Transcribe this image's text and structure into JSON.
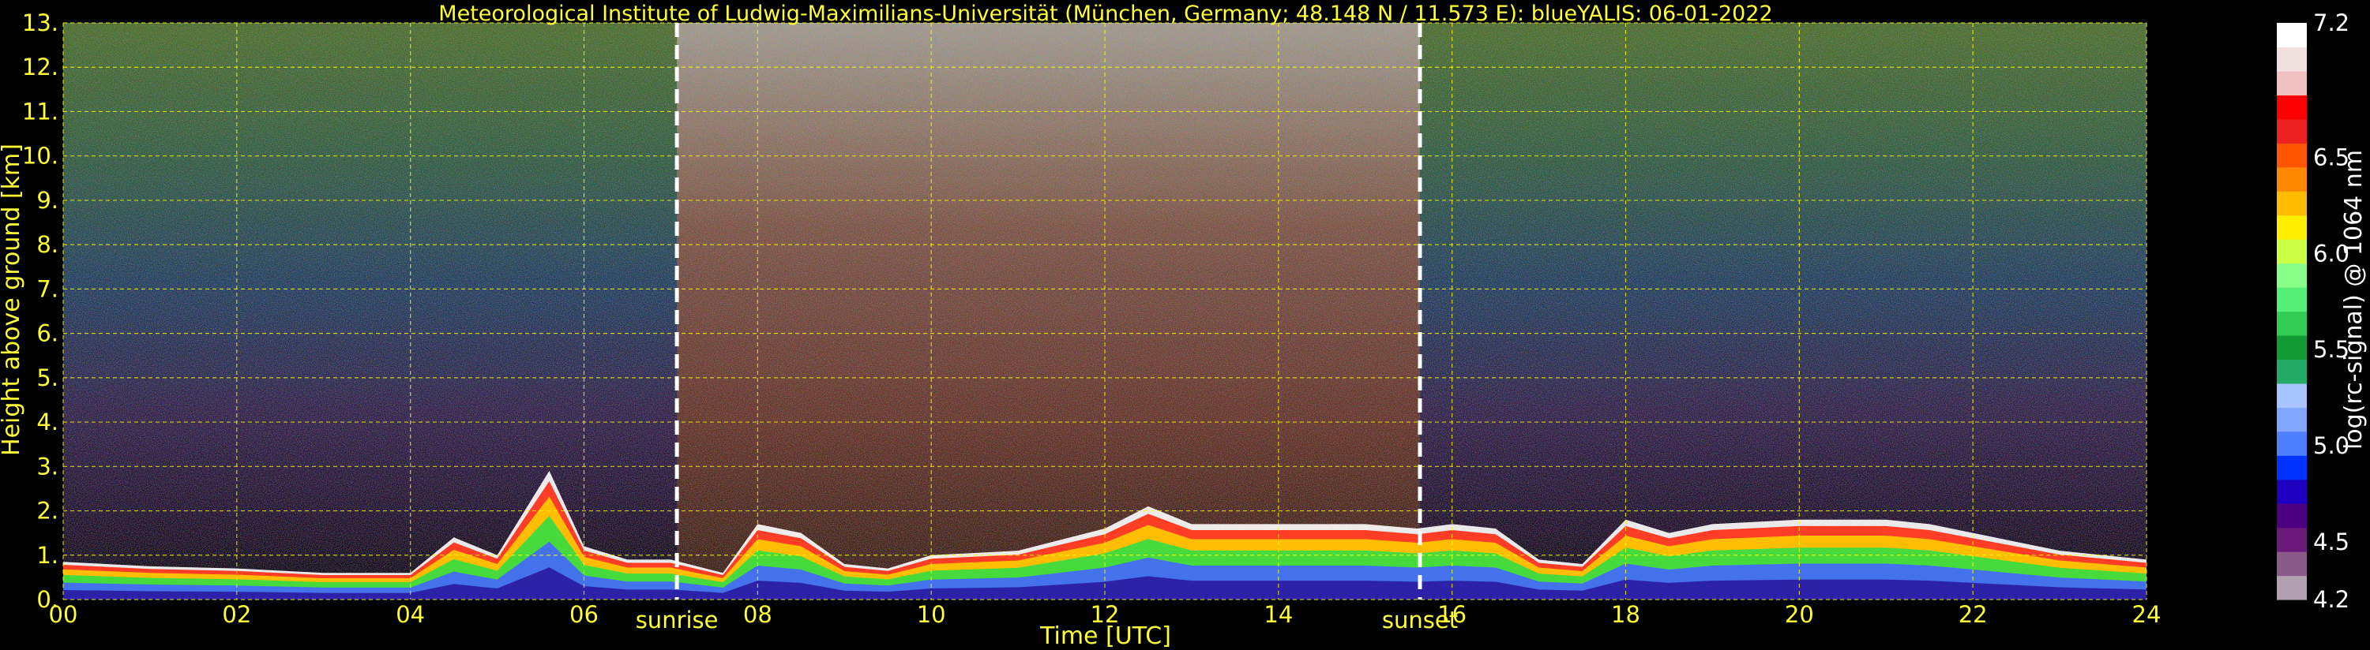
{
  "chart_data": {
    "type": "heatmap",
    "title": "Meteorological Institute of Ludwig-Maximilians-Universität (München, Germany; 48.148 N / 11.573 E):     blueYALIS: 06-01-2022",
    "xlabel": "Time [UTC]",
    "ylabel": "Height above ground [km]",
    "xlim": [
      0,
      24
    ],
    "ylim": [
      0,
      13
    ],
    "x_ticks": [
      "00",
      "02",
      "04",
      "06",
      "08",
      "10",
      "12",
      "14",
      "16",
      "18",
      "20",
      "22",
      "24"
    ],
    "y_ticks": [
      "0.",
      "1.",
      "2.",
      "3.",
      "4.",
      "5.",
      "6.",
      "7.",
      "8.",
      "9.",
      "10.",
      "11.",
      "12.",
      "13."
    ],
    "grid": true,
    "events": [
      {
        "label": "sunrise",
        "x": 7.07
      },
      {
        "label": "sunset",
        "x": 15.63
      }
    ],
    "colorbar": {
      "label": "log(rc-signal) @ 1064 nm",
      "range": [
        4.2,
        7.2
      ],
      "ticks": [
        "4.2",
        "4.5",
        "5.0",
        "5.5",
        "6.0",
        "6.5",
        "7.2"
      ],
      "colors": [
        "#b0a0b0",
        "#8a5a8a",
        "#6a1a7a",
        "#4a0080",
        "#2000c0",
        "#0033ff",
        "#4d7fff",
        "#80a6ff",
        "#a8c4ff",
        "#22aa66",
        "#119933",
        "#33cc55",
        "#55ee77",
        "#88ff88",
        "#ccff44",
        "#ffee00",
        "#ffbb00",
        "#ff8800",
        "#ff5500",
        "#ee2222",
        "#ff0000",
        "#f0c0c0",
        "#f0e0e0",
        "#ffffff"
      ]
    },
    "boundary_layer_top_km": {
      "x": [
        0,
        1,
        2,
        3,
        4,
        4.5,
        5,
        5.6,
        6,
        6.5,
        7,
        7.6,
        8,
        8.5,
        9,
        9.5,
        10,
        11,
        12,
        12.5,
        13,
        14,
        15,
        15.6,
        16,
        16.5,
        17,
        17.5,
        18,
        18.5,
        19,
        20,
        21,
        21.5,
        22,
        23,
        24
      ],
      "y": [
        0.85,
        0.75,
        0.7,
        0.6,
        0.6,
        1.4,
        1.0,
        2.9,
        1.2,
        0.9,
        0.9,
        0.6,
        1.7,
        1.5,
        0.8,
        0.7,
        1.0,
        1.1,
        1.6,
        2.1,
        1.7,
        1.7,
        1.7,
        1.6,
        1.7,
        1.6,
        0.9,
        0.8,
        1.8,
        1.5,
        1.7,
        1.8,
        1.8,
        1.7,
        1.5,
        1.1,
        0.9
      ]
    }
  }
}
